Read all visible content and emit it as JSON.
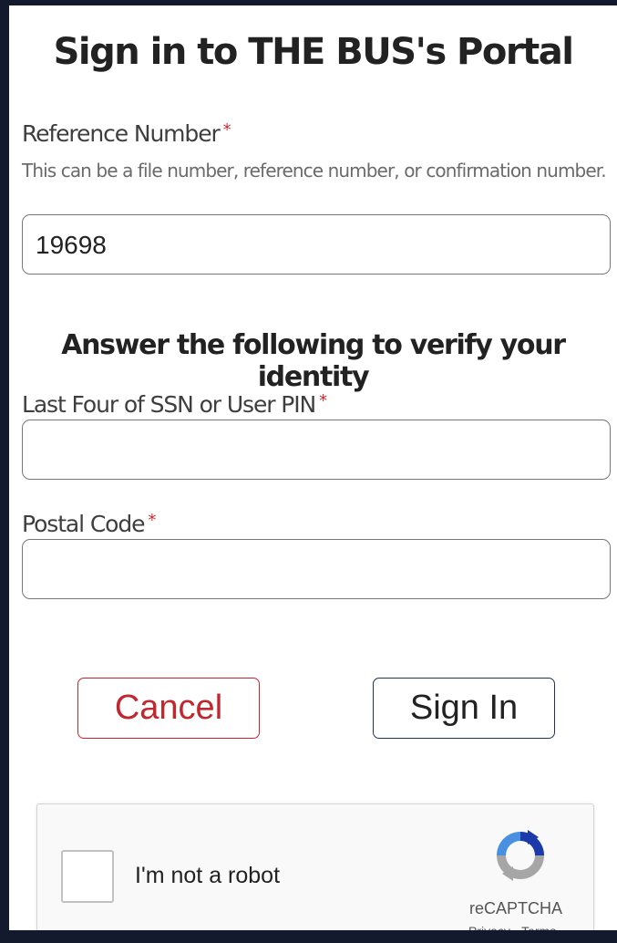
{
  "page": {
    "title": "Sign in to THE BUS's Portal"
  },
  "reference": {
    "label": "Reference Number",
    "required_mark": "*",
    "help": "This can be a file number, reference number, or confirmation number.",
    "value": "19698"
  },
  "verify": {
    "heading": "Answer the following to verify your identity"
  },
  "ssn": {
    "label": "Last Four of SSN or User PIN",
    "required_mark": "*",
    "value": ""
  },
  "postal": {
    "label": "Postal Code",
    "required_mark": "*",
    "value": ""
  },
  "actions": {
    "cancel_label": "Cancel",
    "signin_label": "Sign In"
  },
  "captcha": {
    "label": "I'm not a robot",
    "brand": "reCAPTCHA",
    "privacy": "Privacy",
    "separator": " - ",
    "terms": "Terms",
    "icon": "recaptcha-logo"
  },
  "colors": {
    "background": "#141a2e",
    "required": "#cc2b2b",
    "cancel": "#c0282d",
    "signin_border": "#223355"
  }
}
